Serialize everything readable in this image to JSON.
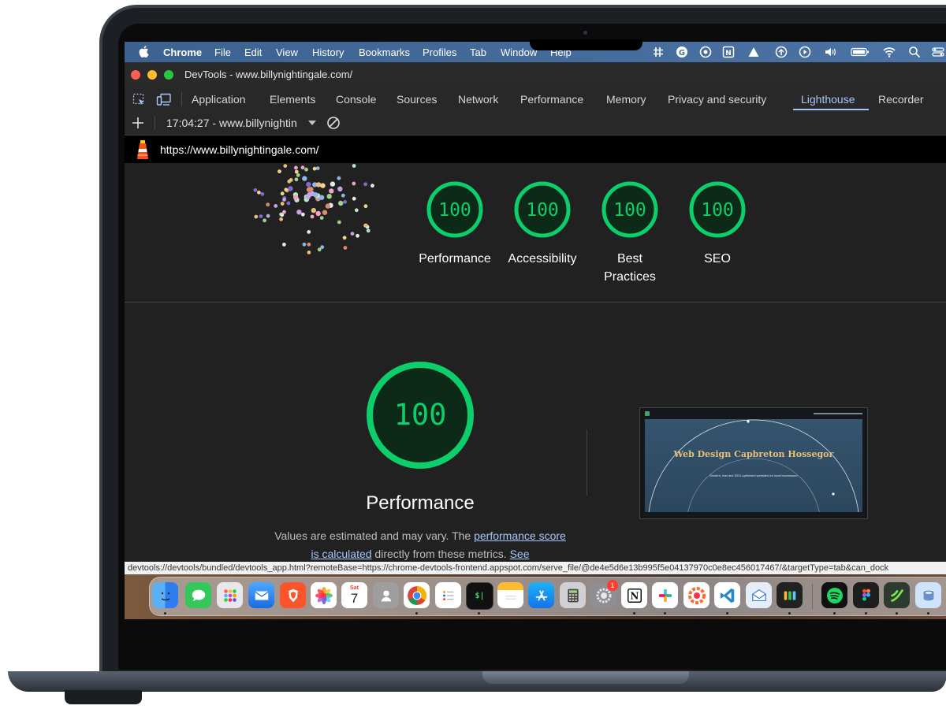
{
  "menubar": {
    "items": [
      "Chrome",
      "File",
      "Edit",
      "View",
      "History",
      "Bookmarks",
      "Profiles",
      "Tab",
      "Window",
      "Help"
    ]
  },
  "devtools": {
    "window_title": "DevTools - www.billynightingale.com/",
    "tabs": [
      "Application",
      "Elements",
      "Console",
      "Sources",
      "Network",
      "Performance",
      "Memory",
      "Privacy and security",
      "Lighthouse",
      "Recorder"
    ],
    "active_tab": "Lighthouse",
    "toolbar": {
      "add_label": "+",
      "report_select": "17:04:27 - www.billynightin"
    },
    "url": "https://www.billynightingale.com/"
  },
  "scores": [
    {
      "label": "Performance",
      "value": "100"
    },
    {
      "label": "Accessibility",
      "value": "100"
    },
    {
      "label": "Best Practices",
      "value": "100"
    },
    {
      "label": "SEO",
      "value": "100"
    }
  ],
  "performance_section": {
    "score": "100",
    "title": "Performance",
    "desc_pre": "Values are estimated and may vary. The ",
    "link1": "performance score is calculated",
    "desc_mid": " directly from these metrics. ",
    "link2": "See"
  },
  "screenshot_preview": {
    "title": "Web Design Capbreton Hossegor",
    "subtitle": "Modern, fast and SEO-optimised websites for local businesses"
  },
  "status_url": "devtools://devtools/bundled/devtools_app.html?remoteBase=https://chrome-devtools-frontend.appspot.com/serve_file/@de4e5d6e13b995f5e04137970c0e8ec456017467/&targetType=tab&can_dock",
  "dock": {
    "badge": "1",
    "calendar_month": "Sat",
    "calendar_day": "7",
    "terminal_prompt": "$|"
  },
  "colors": {
    "score_green": "#0cce6b",
    "active_tab": "#a8c7fa",
    "menubar": "#4b73a4"
  }
}
